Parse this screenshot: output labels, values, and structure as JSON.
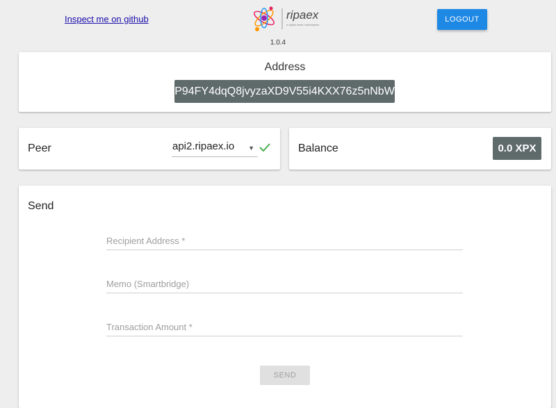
{
  "header": {
    "github_link": "Inspect me on github",
    "logo_text": "ripaex",
    "logo_tagline": "a digital asset marketplace",
    "version": "1.0.4",
    "logout_label": "LOGOUT"
  },
  "address_card": {
    "title": "Address",
    "address": "P94FY4dqQ8jvyzaXD9V55i4KXX76z5nNbW"
  },
  "peer_card": {
    "label": "Peer",
    "selected_peer": "api2.ripaex.io",
    "status_icon": "check-icon"
  },
  "balance_card": {
    "label": "Balance",
    "balance": "0.0 XPX"
  },
  "send_card": {
    "title": "Send",
    "recipient_placeholder": "Recipient Address *",
    "memo_placeholder": "Memo (Smartbridge)",
    "amount_placeholder": "Transaction Amount *",
    "send_label": "SEND"
  },
  "colors": {
    "primary": "#1e88e5",
    "chip": "#5f6a6a",
    "success": "#4caf50",
    "background": "#eeeeee"
  }
}
